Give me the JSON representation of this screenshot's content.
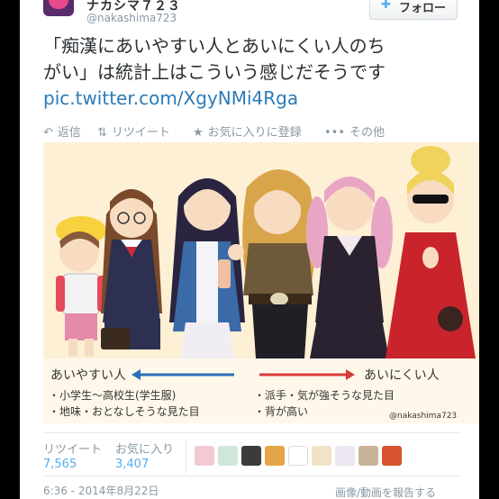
{
  "account": {
    "display_name": "ナカシマ７２３",
    "handle": "@nakashima723",
    "follow_label": "フォロー",
    "follow_icon": "add-user-icon"
  },
  "tweet": {
    "line1": "「痴漢にあいやすい人とあいにくい人のち",
    "line2": "がい」は統計上はこういう感じだそうです",
    "link": "pic.twitter.com/XgyNMi4Rga"
  },
  "actions": {
    "reply": "返信",
    "retweet": "リツイート",
    "favorite": "お気に入りに登録",
    "more": "その他"
  },
  "illustration": {
    "left_heading": "あいやすい人",
    "left_item1": "・小学生〜高校生(学生服)",
    "left_item2": "・地味・おとなしそうな見た目",
    "right_heading": "あいにくい人",
    "right_item1": "・派手・気が強そうな見た目",
    "right_item2": "・背が高い",
    "credit": "@nakashima723",
    "colors": {
      "left_arrow": "#2a6fb6",
      "right_arrow": "#d93a3a",
      "background": "#fff8ea"
    }
  },
  "stats": {
    "retweet_label": "リツイート",
    "retweet_count": "7,565",
    "favorite_label": "お気に入り",
    "favorite_count": "3,407"
  },
  "footer": {
    "timestamp": "6:36 - 2014年8月22日",
    "report": "画像/動画を報告する"
  }
}
